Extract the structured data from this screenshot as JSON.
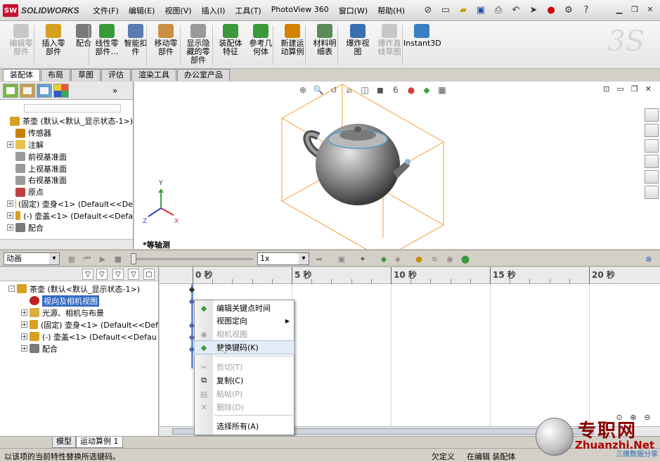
{
  "app": {
    "logo_badge": "SW",
    "logo_text": "SOLIDWORKS",
    "menus": [
      "文件(F)",
      "编辑(E)",
      "视图(V)",
      "插入(I)",
      "工具(T)",
      "PhotoView 360",
      "窗口(W)",
      "帮助(H)"
    ]
  },
  "ribbon": {
    "buttons": [
      {
        "label": "编辑零\n部件",
        "icon": "edit-component-icon",
        "disabled": true
      },
      {
        "label": "插入零\n部件",
        "icon": "insert-component-icon",
        "disabled": false
      },
      {
        "label": "配合",
        "icon": "mate-icon",
        "disabled": false
      },
      {
        "label": "线性零\n部件…",
        "icon": "linear-pattern-icon",
        "disabled": false
      },
      {
        "label": "智能扣\n件",
        "icon": "smart-fastener-icon",
        "disabled": false
      },
      {
        "label": "移动零\n部件",
        "icon": "move-component-icon",
        "disabled": false
      },
      {
        "label": "显示隐\n藏的零\n部件",
        "icon": "show-hidden-icon",
        "disabled": false
      },
      {
        "label": "装配体\n特征",
        "icon": "assembly-feature-icon",
        "disabled": false
      },
      {
        "label": "参考几\n何体",
        "icon": "reference-geometry-icon",
        "disabled": false
      },
      {
        "label": "新建运\n动算例",
        "icon": "new-motion-study-icon",
        "disabled": false
      },
      {
        "label": "材料明\n细表",
        "icon": "bom-icon",
        "disabled": false
      },
      {
        "label": "爆炸视\n图",
        "icon": "exploded-view-icon",
        "disabled": false
      },
      {
        "label": "爆炸直\n线草图",
        "icon": "explode-line-sketch-icon",
        "disabled": true
      },
      {
        "label": "Instant3D",
        "icon": "instant3d-icon",
        "disabled": false
      }
    ]
  },
  "command_tabs": [
    "装配体",
    "布局",
    "草图",
    "评估",
    "渲染工具",
    "办公室产品"
  ],
  "feature_tree": {
    "items": [
      {
        "label": "茶壶  (默认<默认_显示状态-1>)",
        "icon": "assembly-icon",
        "expand": false,
        "indent": 0
      },
      {
        "label": "传感器",
        "icon": "sensor-icon",
        "expand": false,
        "indent": 1
      },
      {
        "label": "注解",
        "icon": "annotation-icon",
        "expand": true,
        "indent": 1
      },
      {
        "label": "前视基准面",
        "icon": "plane-icon",
        "expand": false,
        "indent": 1
      },
      {
        "label": "上视基准面",
        "icon": "plane-icon",
        "expand": false,
        "indent": 1
      },
      {
        "label": "右视基准面",
        "icon": "plane-icon",
        "expand": false,
        "indent": 1
      },
      {
        "label": "原点",
        "icon": "origin-icon",
        "expand": false,
        "indent": 1
      },
      {
        "label": "(固定) 壶身<1> (Default<<De",
        "icon": "part-icon",
        "expand": true,
        "indent": 1
      },
      {
        "label": "(-) 壶盖<1> (Default<<Defa",
        "icon": "part-icon",
        "expand": true,
        "indent": 1
      },
      {
        "label": "配合",
        "icon": "mates-folder-icon",
        "expand": true,
        "indent": 1
      }
    ]
  },
  "graphics": {
    "view_name": "*等轴测",
    "axes": {
      "x": "X",
      "y": "Y",
      "z": "Z"
    }
  },
  "motion_toolbar": {
    "study_type": "动画",
    "speed": "1x"
  },
  "motion_tree": {
    "items": [
      {
        "label": "茶壶  (默认<默认_显示状态-1>)",
        "icon": "assembly-icon",
        "expand": "-",
        "indent": 0,
        "selected": false
      },
      {
        "label": "视向及相机视图",
        "icon": "camera-view-icon",
        "expand": "",
        "indent": 1,
        "selected": true
      },
      {
        "label": "光源、相机与布景",
        "icon": "lights-folder-icon",
        "expand": "+",
        "indent": 1,
        "selected": false
      },
      {
        "label": "(固定) 壶身<1> (Default<<Def",
        "icon": "part-icon",
        "expand": "+",
        "indent": 1,
        "selected": false
      },
      {
        "label": "(-) 壶盖<1> (Default<<Defau",
        "icon": "part-icon",
        "expand": "+",
        "indent": 1,
        "selected": false
      },
      {
        "label": "配合",
        "icon": "mates-folder-icon",
        "expand": "+",
        "indent": 1,
        "selected": false
      }
    ]
  },
  "timeline": {
    "labels": [
      "0 秒",
      "5 秒",
      "10 秒",
      "15 秒",
      "20 秒"
    ]
  },
  "context_menu": {
    "items": [
      {
        "label": "编辑关键点时间",
        "icon": "edit-key-time-icon",
        "disabled": false,
        "submenu": false
      },
      {
        "label": "视图定向",
        "icon": "",
        "disabled": false,
        "submenu": true
      },
      {
        "label": "相机视图",
        "icon": "camera-icon",
        "disabled": true,
        "submenu": false
      },
      {
        "label": "替换键码(K)",
        "icon": "replace-key-icon",
        "disabled": false,
        "submenu": false,
        "hover": true
      },
      {
        "label": "剪切(T)",
        "icon": "cut-icon",
        "disabled": true,
        "submenu": false
      },
      {
        "label": "复制(C)",
        "icon": "copy-icon",
        "disabled": false,
        "submenu": false
      },
      {
        "label": "粘帖(P)",
        "icon": "paste-icon",
        "disabled": true,
        "submenu": false
      },
      {
        "label": "删除(D)",
        "icon": "delete-icon",
        "disabled": true,
        "submenu": false
      },
      {
        "label": "选择所有(A)",
        "icon": "",
        "disabled": false,
        "submenu": false
      }
    ]
  },
  "bottom_tabs": [
    "模型",
    "运动算例 1"
  ],
  "status": {
    "message": "以该项的当前特性替换所选键码。",
    "cells": [
      "欠定义",
      "在编辑 装配体",
      ""
    ]
  },
  "watermark": {
    "main": "专职网",
    "url": "Zhuanzhi.Net",
    "sub": "三维数据分享"
  },
  "colors": {
    "selection": "#316ac5",
    "bounding_box": "#f0a030",
    "brand_red": "#c8102e"
  }
}
